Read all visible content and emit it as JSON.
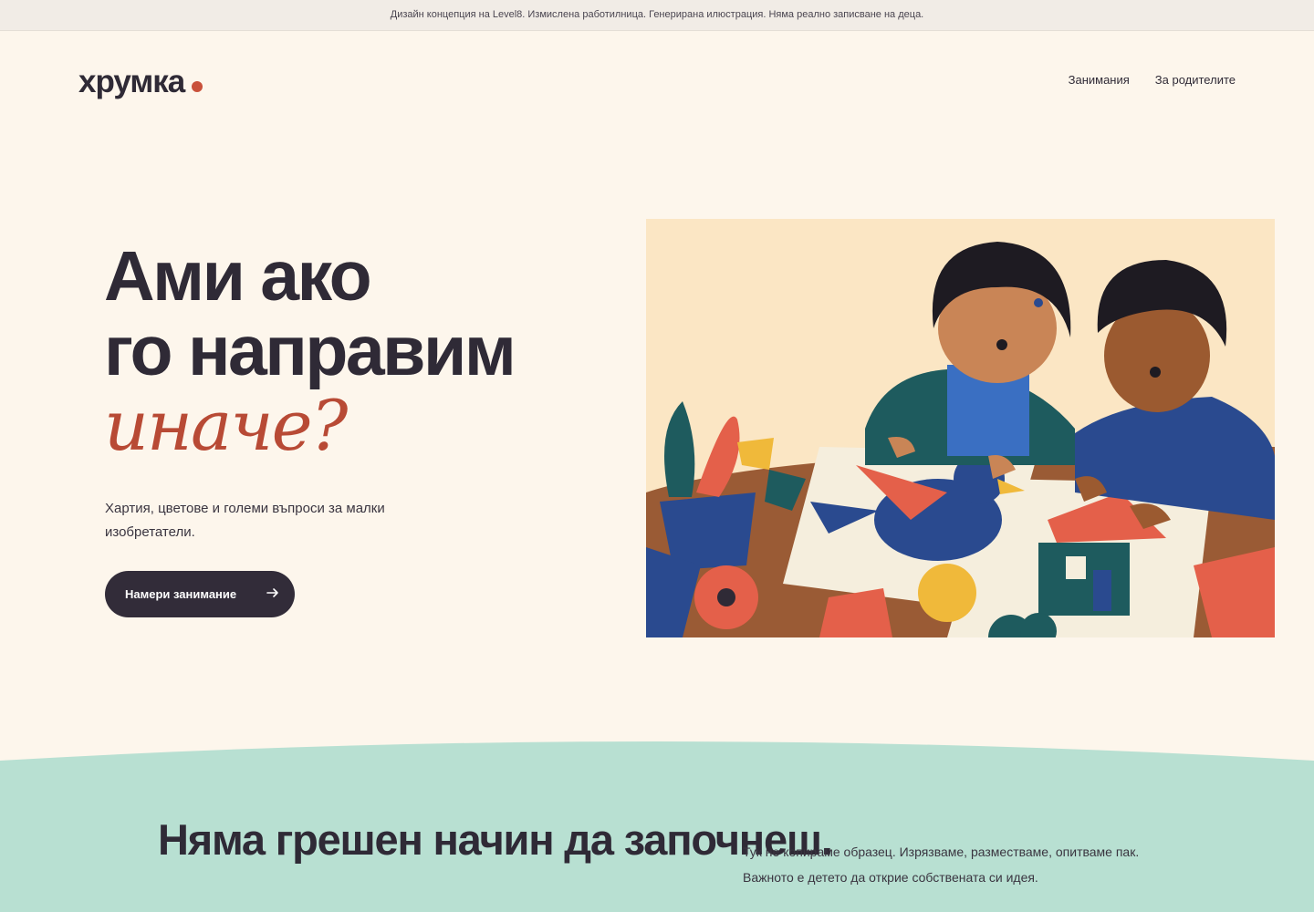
{
  "notice": "Дизайн концепция на Level8. Измислена работилница. Генерирана илюстрация. Няма реално записване на деца.",
  "brand": {
    "name": "хрумка"
  },
  "nav": {
    "items": [
      "Занимания",
      "За родителите"
    ]
  },
  "hero": {
    "title_line1": "Ами ако",
    "title_line2": "го направим",
    "title_accent": "иначе?",
    "subtitle": "Хартия, цветове и големи въпроси за малки изобретатели.",
    "cta_label": "Намери занимание"
  },
  "section": {
    "title": "Няма грешен начин да започнеш.",
    "text": "Тук не копираме образец. Изрязваме, разместваме, опитваме пак. Важното е детето да открие собствената си идея."
  },
  "colors": {
    "background": "#fdf6ec",
    "accent": "#c9513b",
    "dark": "#322c39",
    "mint": "#b8e0d2"
  }
}
